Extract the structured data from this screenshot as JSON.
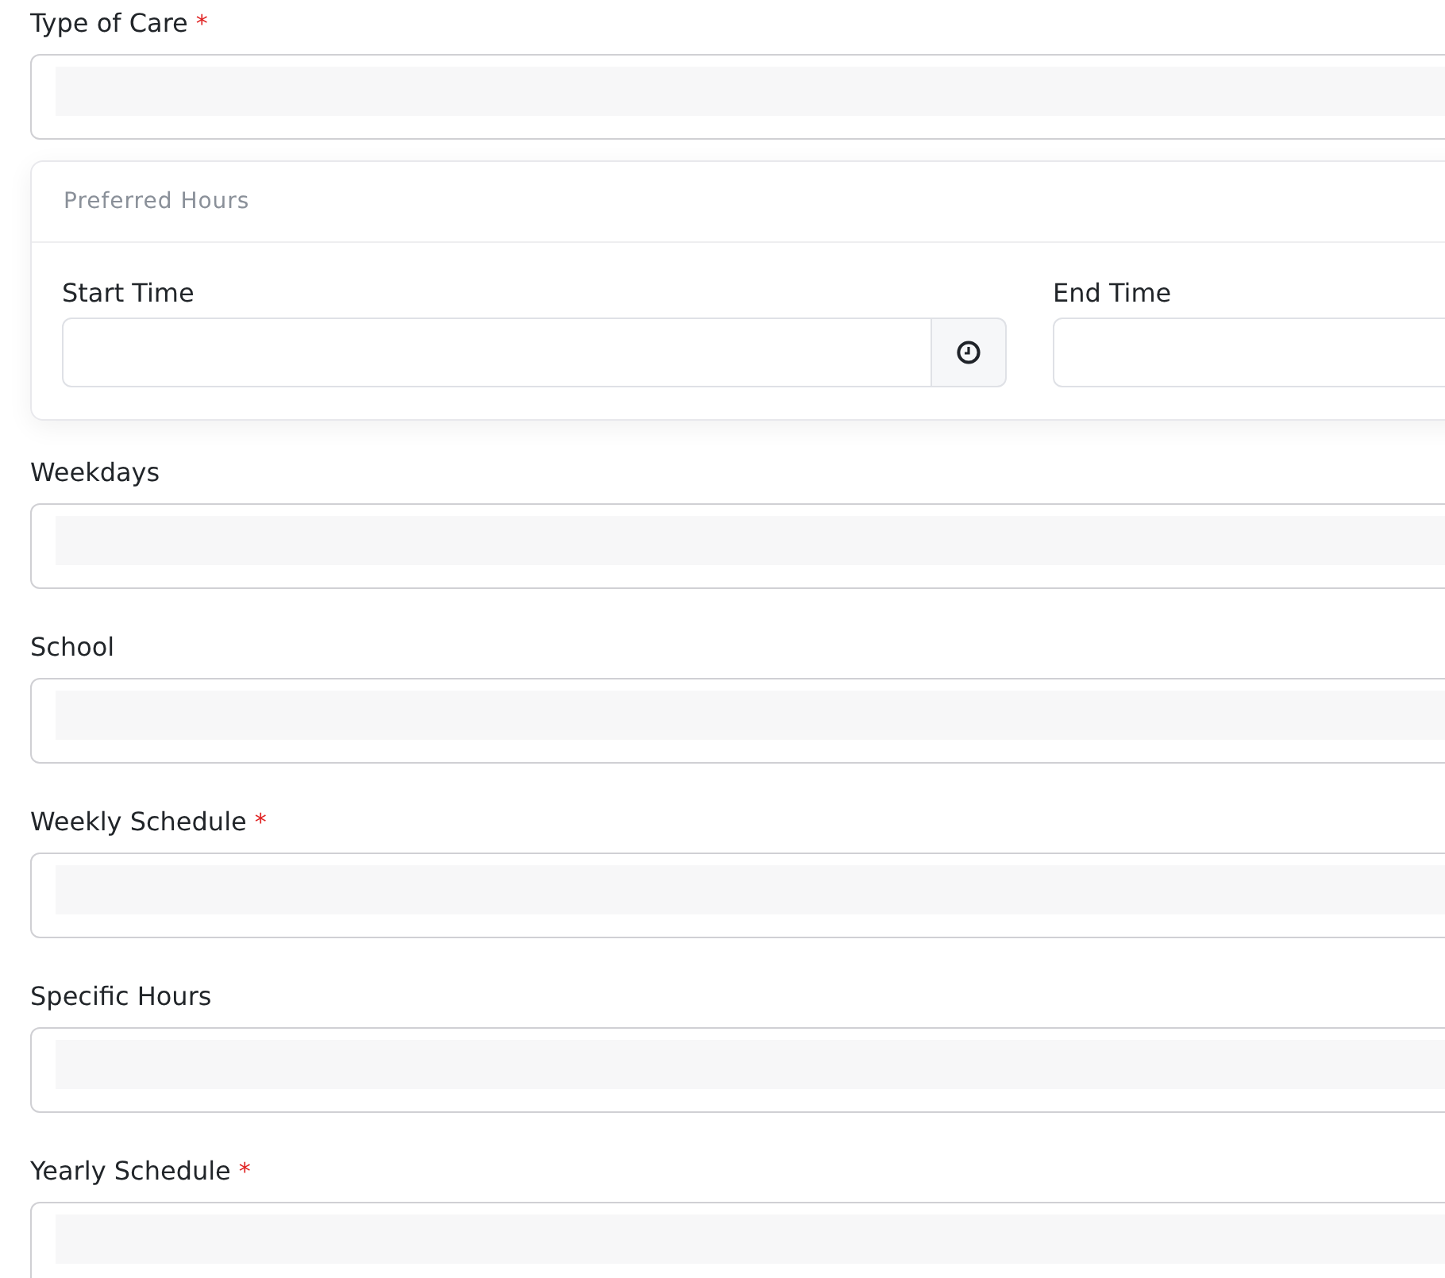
{
  "sections": [
    {
      "kind": "field",
      "label": "Type of Care",
      "required_marker": "*"
    },
    {
      "kind": "group",
      "title": "Preferred Hours",
      "fields": [
        {
          "label": "Start Time",
          "addon": true
        },
        {
          "label": "End Time"
        }
      ]
    },
    {
      "kind": "field",
      "label": "Weekdays"
    },
    {
      "kind": "field",
      "label": "School"
    },
    {
      "kind": "field",
      "label": "Weekly Schedule",
      "required_marker": "*"
    },
    {
      "kind": "field",
      "label": "Specific Hours"
    },
    {
      "kind": "field",
      "label": "Yearly Schedule",
      "required_marker": "*"
    }
  ]
}
